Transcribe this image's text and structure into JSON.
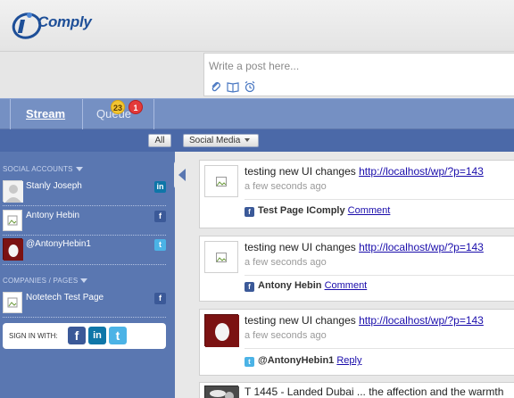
{
  "app": {
    "logo_text": "Comply"
  },
  "composer": {
    "placeholder": "Write a post here..."
  },
  "tabs": [
    {
      "label": "Stream",
      "active": true
    },
    {
      "label": "Queue",
      "active": false
    }
  ],
  "queue_badges": {
    "pending": "23",
    "alerts": "1"
  },
  "filters": {
    "all_label": "All",
    "social_media_label": "Social Media"
  },
  "sidebar": {
    "social_accounts_title": "SOCIAL ACCOUNTS",
    "accounts": [
      {
        "name": "Stanly Joseph",
        "network": "linkedin",
        "network_glyph": "in"
      },
      {
        "name": "Antony Hebin",
        "network": "facebook",
        "network_glyph": "f"
      },
      {
        "name": "@AntonyHebin1",
        "network": "twitter",
        "network_glyph": "t"
      }
    ],
    "pages_title": "COMPANIES / PAGES",
    "pages": [
      {
        "name": "Notetech Test Page",
        "network": "facebook",
        "network_glyph": "f"
      }
    ],
    "signin_label": "SIGN IN WITH:",
    "signin_buttons": [
      {
        "network": "facebook",
        "glyph": "f"
      },
      {
        "network": "linkedin",
        "glyph": "in"
      },
      {
        "network": "twitter",
        "glyph": "t"
      }
    ]
  },
  "posts": [
    {
      "text": "testing new UI changes ",
      "link": "http://localhost/wp/?p=143",
      "time": "a few seconds ago",
      "network": "facebook",
      "author": "Test Page IComply",
      "action": "Comment"
    },
    {
      "text": "testing new UI changes ",
      "link": "http://localhost/wp/?p=143",
      "time": "a few seconds ago",
      "network": "facebook",
      "author": "Antony Hebin",
      "action": "Comment"
    },
    {
      "text": "testing new UI changes ",
      "link": "http://localhost/wp/?p=143",
      "time": "a few seconds ago",
      "network": "twitter",
      "author": "@AntonyHebin1",
      "action": "Reply"
    },
    {
      "text": "T 1445 - Landed Dubai ... the affection and the warmth"
    }
  ],
  "colors": {
    "facebook": "#3b5998",
    "linkedin": "#0e76a8",
    "twitter": "#4bb3e6",
    "sidebar": "#5a77b1",
    "tabs": "#7590c3",
    "filterbar": "#4b69a8"
  }
}
